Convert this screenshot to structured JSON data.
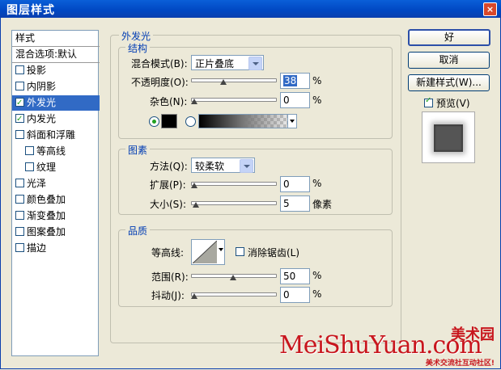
{
  "window": {
    "title": "图层样式",
    "close_glyph": "×"
  },
  "style_list": {
    "header": "样式",
    "blend_options": "混合选项:默认",
    "items": [
      {
        "label": "投影",
        "checked": false,
        "indent": false,
        "selected": false
      },
      {
        "label": "内阴影",
        "checked": false,
        "indent": false,
        "selected": false
      },
      {
        "label": "外发光",
        "checked": true,
        "indent": false,
        "selected": true
      },
      {
        "label": "内发光",
        "checked": true,
        "indent": false,
        "selected": false
      },
      {
        "label": "斜面和浮雕",
        "checked": false,
        "indent": false,
        "selected": false
      },
      {
        "label": "等高线",
        "checked": false,
        "indent": true,
        "selected": false
      },
      {
        "label": "纹理",
        "checked": false,
        "indent": true,
        "selected": false
      },
      {
        "label": "光泽",
        "checked": false,
        "indent": false,
        "selected": false
      },
      {
        "label": "颜色叠加",
        "checked": false,
        "indent": false,
        "selected": false
      },
      {
        "label": "渐变叠加",
        "checked": false,
        "indent": false,
        "selected": false
      },
      {
        "label": "图案叠加",
        "checked": false,
        "indent": false,
        "selected": false
      },
      {
        "label": "描边",
        "checked": false,
        "indent": false,
        "selected": false
      }
    ]
  },
  "outer_glow": {
    "title": "外发光",
    "structure": {
      "title": "结构",
      "blend_mode_label": "混合模式(B):",
      "blend_mode_value": "正片叠底",
      "opacity_label": "不透明度(O):",
      "opacity_value": "38",
      "opacity_slider": 0.38,
      "noise_label": "杂色(N):",
      "noise_value": "0",
      "noise_slider": 0,
      "percent": "%"
    },
    "elements": {
      "title": "图素",
      "method_label": "方法(Q):",
      "method_value": "较柔软",
      "spread_label": "扩展(P):",
      "spread_value": "0",
      "spread_slider": 0,
      "size_label": "大小(S):",
      "size_value": "5",
      "size_slider": 0.02,
      "percent": "%",
      "size_unit": "像素"
    },
    "quality": {
      "title": "品质",
      "contour_label": "等高线:",
      "antialias_label": "消除锯齿(L)",
      "antialias_checked": false,
      "range_label": "范围(R):",
      "range_value": "50",
      "range_slider": 0.5,
      "jitter_label": "抖动(J):",
      "jitter_value": "0",
      "jitter_slider": 0,
      "percent": "%"
    }
  },
  "buttons": {
    "ok": "好",
    "cancel": "取消",
    "new_style": "新建样式(W)...",
    "preview_label": "预览(V)",
    "preview_checked": true
  },
  "watermark": {
    "brand": "美术园",
    "url_text": "MeiShuYuan.com",
    "tagline": "美术交流社互动社区!"
  },
  "colors": {
    "accent_blue": "#003cb3",
    "selection": "#316ac5",
    "watermark_red": "#c8161d",
    "glow_color": "#000000"
  }
}
